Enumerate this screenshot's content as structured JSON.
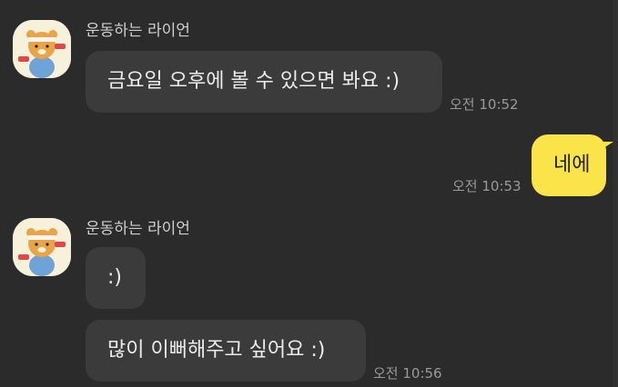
{
  "messages": [
    {
      "sender": "운동하는 라이언",
      "text": "금요일 오후에 볼 수 있으면 봐요 :)",
      "time": "오전 10:52"
    },
    {
      "text": "네에",
      "time": "오전 10:53"
    },
    {
      "sender": "운동하는 라이언",
      "text": ":)"
    },
    {
      "text": "많이 이뻐해주고 싶어요 :)",
      "time": "오전 10:56"
    }
  ],
  "colors": {
    "background": "#2b2b2b",
    "incoming_bubble": "#3b3b3b",
    "outgoing_bubble": "#fbe34a"
  }
}
